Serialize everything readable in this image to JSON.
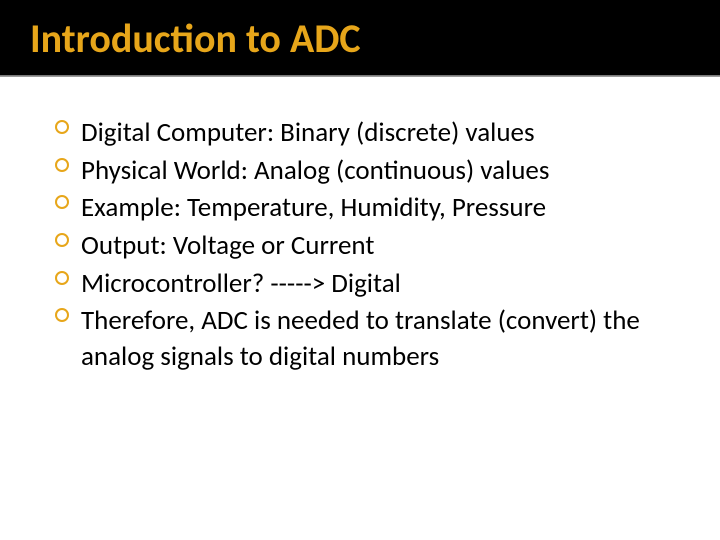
{
  "title": "Introduction to ADC",
  "bullets": [
    "Digital Computer: Binary (discrete) values",
    "Physical World: Analog (continuous) values",
    "Example: Temperature,  Humidity, Pressure",
    "Output: Voltage or Current",
    "Microcontroller? -----> Digital",
    "Therefore, ADC is needed to translate (convert) the analog signals to digital numbers"
  ]
}
